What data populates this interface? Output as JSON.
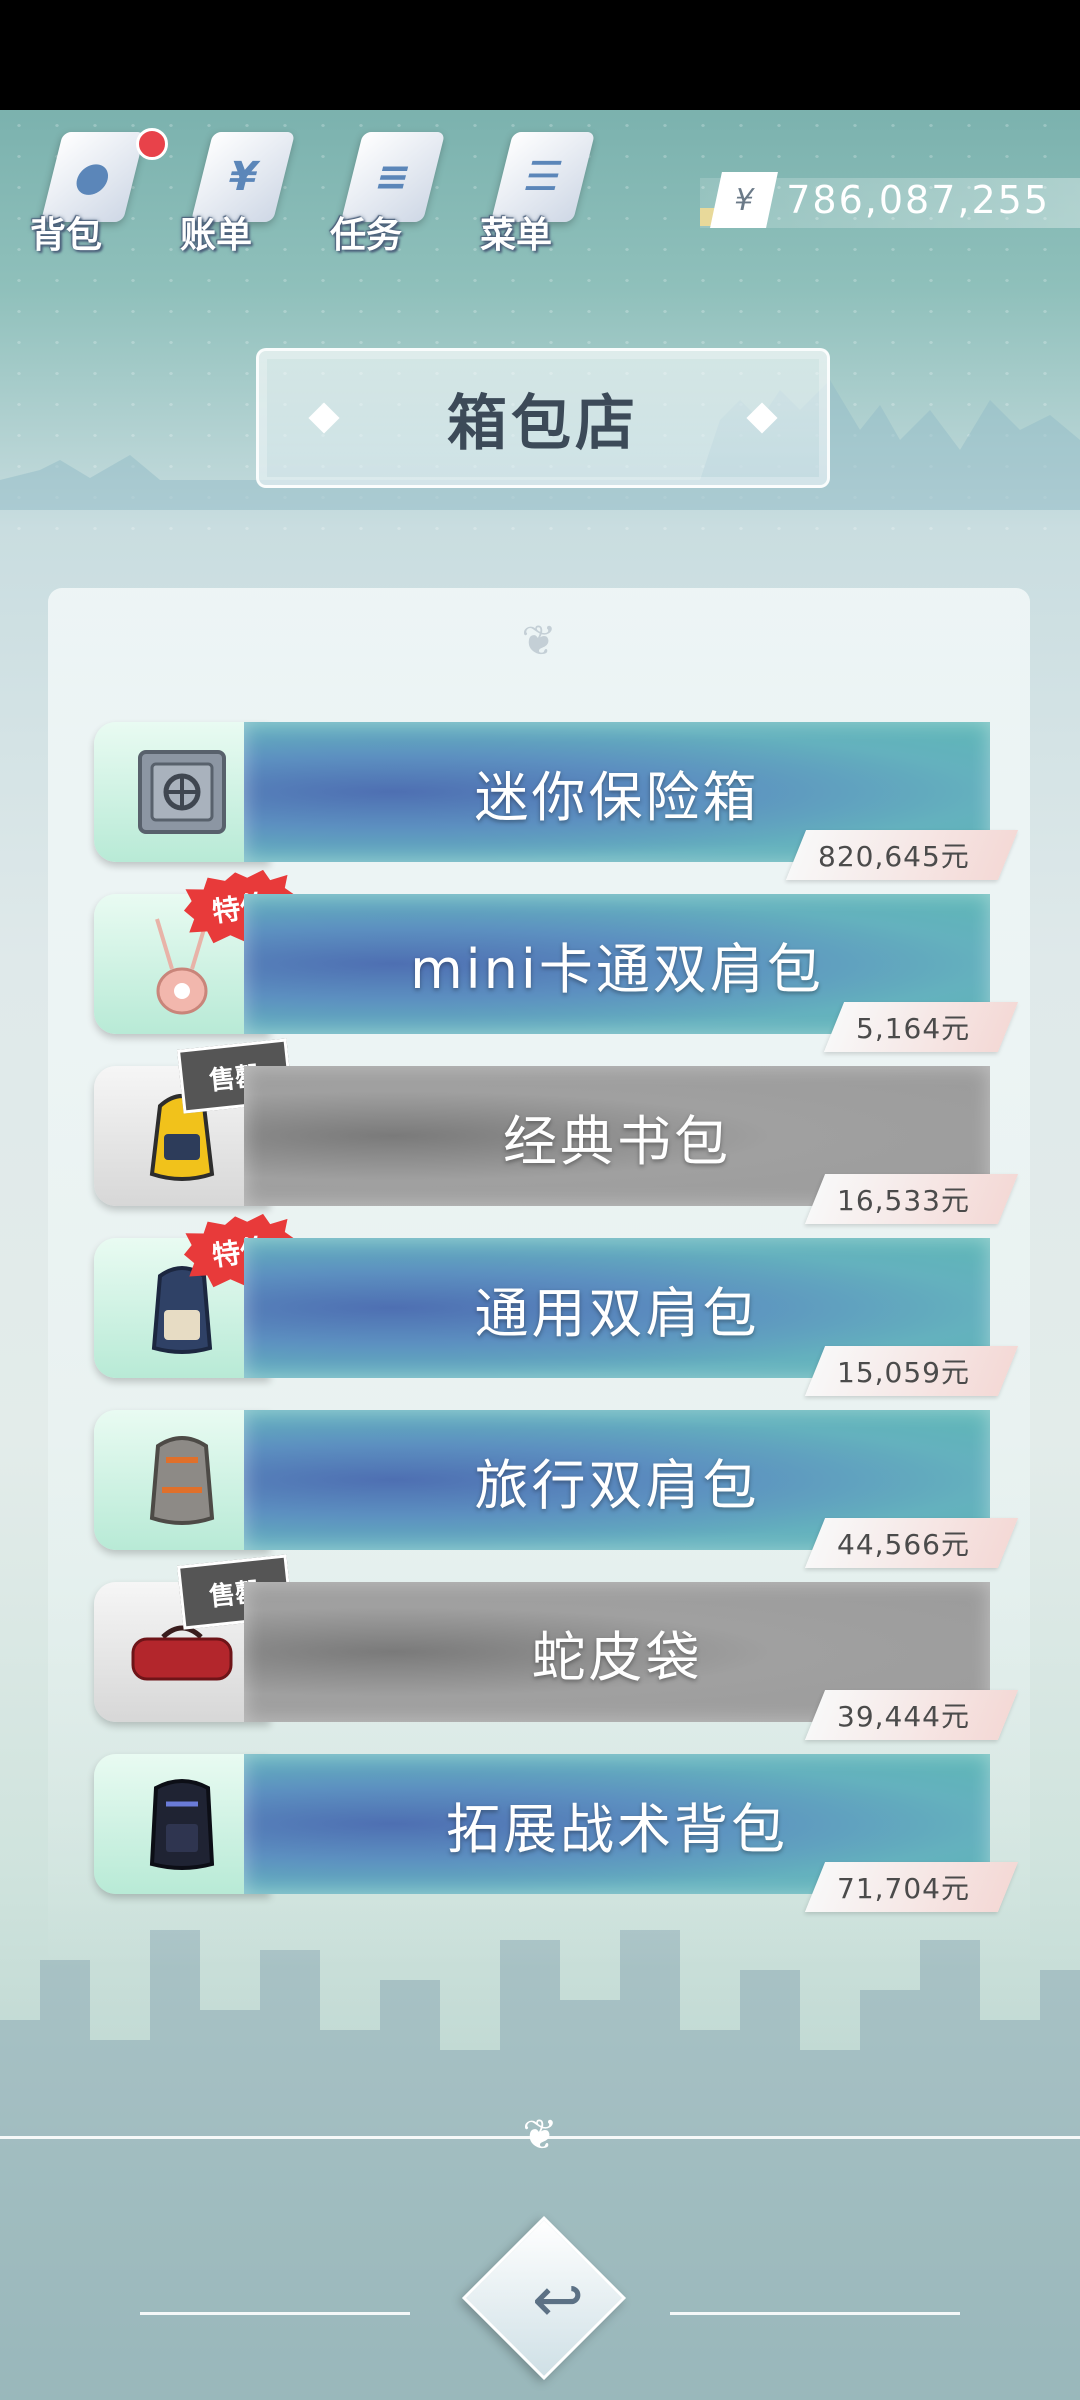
{
  "nav": {
    "items": [
      {
        "label": "背包",
        "icon": "backpack-icon",
        "has_notification": true
      },
      {
        "label": "账单",
        "icon": "bill-icon",
        "glyph": "¥"
      },
      {
        "label": "任务",
        "icon": "task-icon"
      },
      {
        "label": "菜单",
        "icon": "menu-icon"
      }
    ]
  },
  "money": {
    "symbol": "¥",
    "amount": "786,087,255"
  },
  "shop": {
    "title": "箱包店"
  },
  "badges": {
    "sale": "特价",
    "sold_out": "售罄"
  },
  "items": [
    {
      "name": "迷你保险箱",
      "price": "820,645元",
      "icon": "safe-icon",
      "status": "normal"
    },
    {
      "name": "mini卡通双肩包",
      "price": "5,164元",
      "icon": "cartoon-backpack-icon",
      "status": "sale"
    },
    {
      "name": "经典书包",
      "price": "16,533元",
      "icon": "school-bag-icon",
      "status": "sold_out"
    },
    {
      "name": "通用双肩包",
      "price": "15,059元",
      "icon": "backpack-icon",
      "status": "sale"
    },
    {
      "name": "旅行双肩包",
      "price": "44,566元",
      "icon": "travel-backpack-icon",
      "status": "normal"
    },
    {
      "name": "蛇皮袋",
      "price": "39,444元",
      "icon": "duffel-bag-icon",
      "status": "sold_out"
    },
    {
      "name": "拓展战术背包",
      "price": "71,704元",
      "icon": "tactical-backpack-icon",
      "status": "normal"
    }
  ],
  "colors": {
    "sale_badge": "#e83a3a",
    "sold_badge": "#555555",
    "banner_active": "#5c8fc0",
    "banner_sold": "#a0a0a0"
  },
  "back_button": {
    "icon": "back-arrow-icon"
  }
}
